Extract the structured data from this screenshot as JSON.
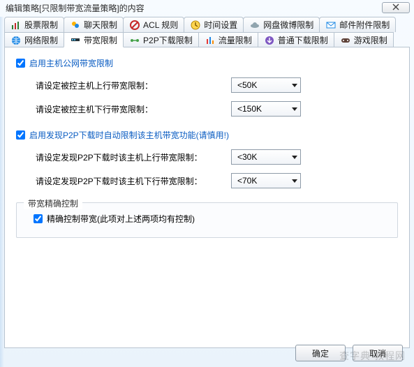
{
  "window": {
    "title": "编辑策略[只限制带宽流量策略]的内容"
  },
  "tabs": {
    "row1": [
      {
        "label": "股票限制"
      },
      {
        "label": "聊天限制"
      },
      {
        "label": "ACL 规则"
      },
      {
        "label": "时间设置"
      },
      {
        "label": "网盘微博限制"
      },
      {
        "label": "邮件附件限制"
      }
    ],
    "row2": [
      {
        "label": "网络限制"
      },
      {
        "label": "带宽限制"
      },
      {
        "label": "P2P下载限制"
      },
      {
        "label": "流量限制"
      },
      {
        "label": "普通下载限制"
      },
      {
        "label": "游戏限制"
      }
    ]
  },
  "panel": {
    "enable_main": "启用主机公网带宽限制",
    "up_label": "请设定被控主机上行带宽限制：",
    "up_value": "<50K",
    "down_label": "请设定被控主机下行带宽限制：",
    "down_value": "<150K",
    "enable_p2p": "启用发现P2P下载时自动限制该主机带宽功能(请慎用!)",
    "p2p_up_label": "请设定发现P2P下载时该主机上行带宽限制：",
    "p2p_up_value": "<30K",
    "p2p_down_label": "请设定发现P2P下载时该主机下行带宽限制：",
    "p2p_down_value": "<70K",
    "precise_legend": "带宽精确控制",
    "precise_label": "精确控制带宽(此项对上述两项均有控制)"
  },
  "buttons": {
    "ok": "确定",
    "cancel": "取消"
  },
  "watermark": "查字典 教程网"
}
